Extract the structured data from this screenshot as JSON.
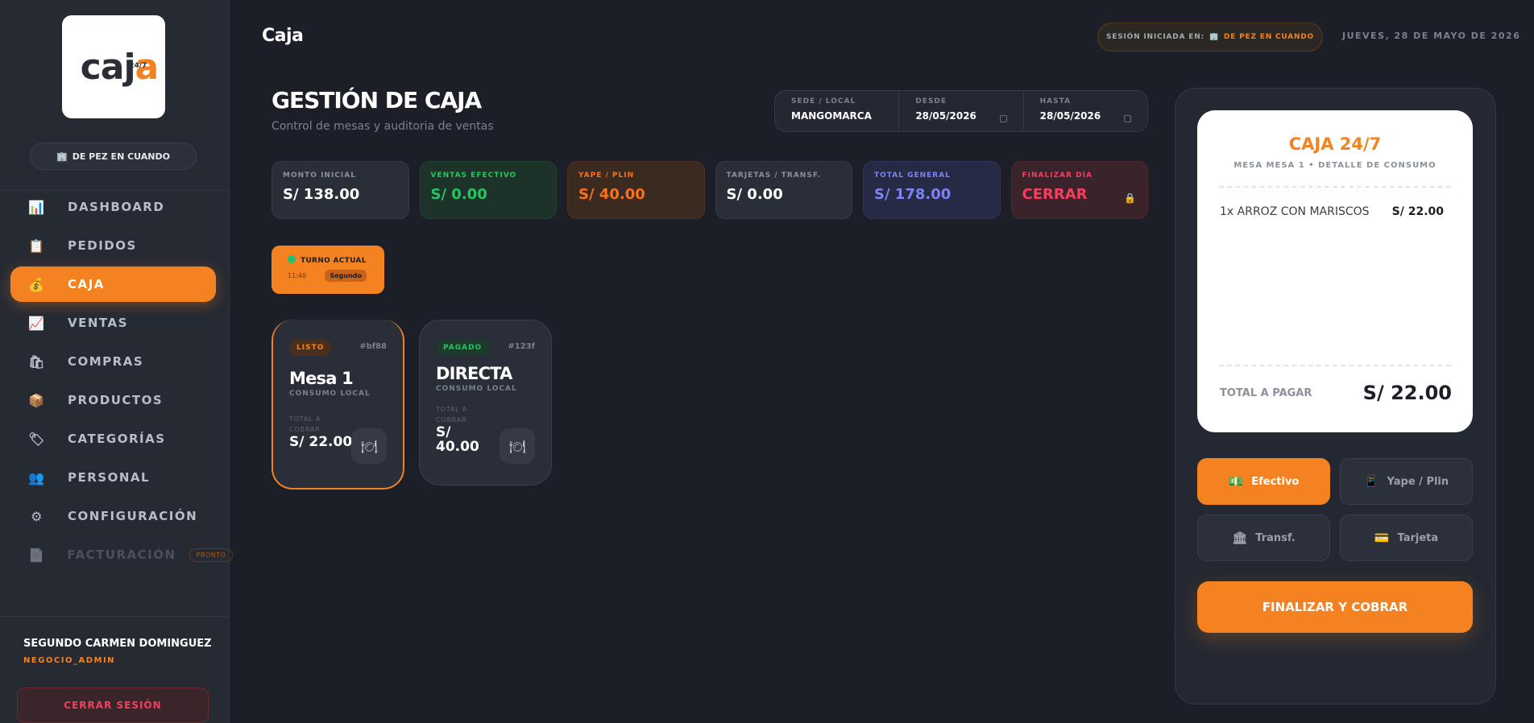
{
  "sidebar": {
    "branch": "DE PEZ EN CUANDO",
    "items": [
      {
        "icon": "📊",
        "label": "DASHBOARD"
      },
      {
        "icon": "📋",
        "label": "PEDIDOS"
      },
      {
        "icon": "💰",
        "label": "CAJA"
      },
      {
        "icon": "📈",
        "label": "VENTAS"
      },
      {
        "icon": "🛍",
        "label": "COMPRAS"
      },
      {
        "icon": "📦",
        "label": "PRODUCTOS"
      },
      {
        "icon": "🏷",
        "label": "CATEGORÍAS"
      },
      {
        "icon": "👥",
        "label": "PERSONAL"
      },
      {
        "icon": "⚙",
        "label": "CONFIGURACIÓN"
      },
      {
        "icon": "📄",
        "label": "FACTURACIÓN",
        "badge": "PRONTO"
      }
    ],
    "user_name": "SEGUNDO CARMEN DOMINGUEZ",
    "user_role": "NEGOCIO_ADMIN",
    "logout_label": "CERRAR SESIÓN"
  },
  "topbar": {
    "title": "Caja",
    "session_label": "SESIÓN INICIADA EN:",
    "session_value": "DE PEZ EN CUANDO",
    "date": "JUEVES, 28 DE MAYO DE 2026"
  },
  "main": {
    "title": "GESTIÓN DE CAJA",
    "subtitle": "Control de mesas y auditoria de ventas",
    "filters": [
      {
        "label": "SEDE / LOCAL",
        "value": "MANGOMARCA"
      },
      {
        "label": "DESDE",
        "value": "28/05/2026"
      },
      {
        "label": "HASTA",
        "value": "28/05/2026"
      }
    ],
    "stats": [
      {
        "label": "MONTO INICIAL",
        "value": "S/ 138.00"
      },
      {
        "label": "VENTAS EFECTIVO",
        "value": "S/ 0.00"
      },
      {
        "label": "YAPE / PLIN",
        "value": "S/ 40.00"
      },
      {
        "label": "TARJETAS / TRANSF.",
        "value": "S/ 0.00"
      },
      {
        "label": "TOTAL GENERAL",
        "value": "S/ 178.00"
      },
      {
        "label": "FINALIZAR DÍA",
        "value": "CERRAR"
      }
    ],
    "turno": {
      "title": "TURNO ACTUAL",
      "time": "11:40",
      "shift": "Segundo"
    },
    "tables": [
      {
        "status": "LISTO",
        "code": "#bf88",
        "name": "Mesa 1",
        "type": "CONSUMO LOCAL",
        "total_label": "TOTAL A COBRAR",
        "total": "S/ 22.00"
      },
      {
        "status": "PAGADO",
        "code": "#123f",
        "name": "DIRECTA",
        "type": "CONSUMO LOCAL",
        "total_label": "TOTAL A COBRAR",
        "total": "S/ 40.00"
      }
    ]
  },
  "panel": {
    "title": "CAJA 24/7",
    "subtitle": "MESA MESA 1 • DETALLE DE CONSUMO",
    "item": {
      "name": "1x ARROZ CON MARISCOS",
      "price": "S/ 22.00"
    },
    "total_label": "TOTAL A PAGAR",
    "total": "S/ 22.00",
    "payments": [
      {
        "icon": "💵",
        "label": "Efectivo"
      },
      {
        "icon": "📱",
        "label": "Yape / Plin"
      },
      {
        "icon": "🏛",
        "label": "Transf."
      },
      {
        "icon": "💳",
        "label": "Tarjeta"
      }
    ],
    "finalize_label": "FINALIZAR Y COBRAR"
  },
  "colors": {
    "accent": "#f58220",
    "background": "#1c1f27",
    "sidebar": "#262a33",
    "success": "#22c55e",
    "danger": "#f43f5e",
    "indigo": "#7c83f5"
  }
}
